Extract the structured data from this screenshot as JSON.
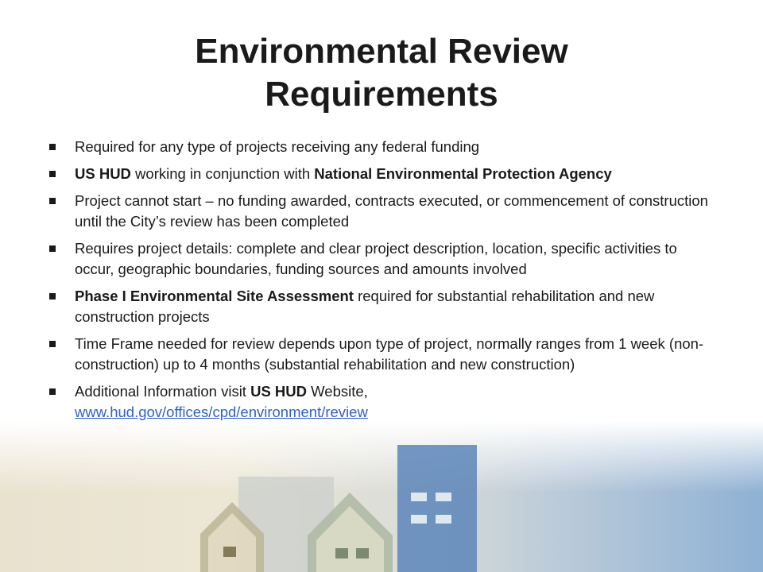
{
  "slide": {
    "title_line1": "Environmental Review",
    "title_line2": "Requirements"
  },
  "bullets": {
    "b1": {
      "text": "Required for any type of projects receiving  any federal funding"
    },
    "b2": {
      "bold1": "US HUD",
      "text1": " working in conjunction with ",
      "bold2": "National Environmental Protection Agency"
    },
    "b3": {
      "text": "Project cannot start – no funding awarded, contracts executed, or commencement of construction until the City’s review has been completed"
    },
    "b4": {
      "text": "Requires project details: complete and clear project description, location, specific activities to occur, geographic boundaries, funding sources and amounts involved"
    },
    "b5": {
      "bold": "Phase I Environmental Site Assessment",
      "text": " required for substantial rehabilitation and new construction projects"
    },
    "b6": {
      "text": "Time Frame needed for review depends upon type of  project, normally ranges from 1 week (non-construction) up to 4 months (substantial rehabilitation and new construction)"
    },
    "b7": {
      "text1": "Additional Information visit ",
      "bold": "US HUD",
      "text2": " Website, ",
      "link": "www.hud.gov/offices/cpd/environment/review"
    }
  },
  "colors": {
    "bullet_marker": "#1a1a1a",
    "link": "#2f5fd0",
    "band_left": "#e9e2cf",
    "band_right": "#8fb1d4"
  }
}
